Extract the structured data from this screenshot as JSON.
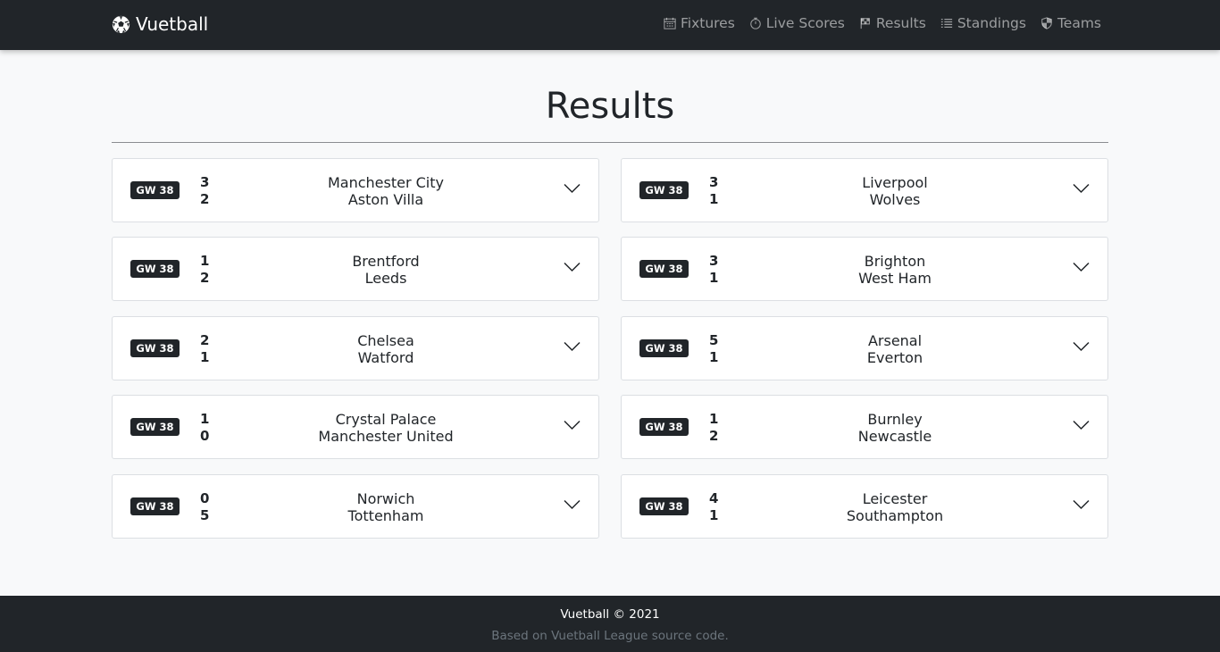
{
  "navbar": {
    "brand": "Vuetball",
    "brand_icon": "soccer-ball-icon",
    "links": [
      {
        "label": "Fixtures",
        "icon": "calendar-icon"
      },
      {
        "label": "Live Scores",
        "icon": "stopwatch-icon"
      },
      {
        "label": "Results",
        "icon": "flag-icon"
      },
      {
        "label": "Standings",
        "icon": "list-icon"
      },
      {
        "label": "Teams",
        "icon": "shield-icon"
      }
    ]
  },
  "page_title": "Results",
  "results": [
    {
      "gameweek": "GW 38",
      "home_score": "3",
      "away_score": "2",
      "home_team": "Manchester City",
      "away_team": "Aston Villa"
    },
    {
      "gameweek": "GW 38",
      "home_score": "3",
      "away_score": "1",
      "home_team": "Liverpool",
      "away_team": "Wolves"
    },
    {
      "gameweek": "GW 38",
      "home_score": "1",
      "away_score": "2",
      "home_team": "Brentford",
      "away_team": "Leeds"
    },
    {
      "gameweek": "GW 38",
      "home_score": "3",
      "away_score": "1",
      "home_team": "Brighton",
      "away_team": "West Ham"
    },
    {
      "gameweek": "GW 38",
      "home_score": "2",
      "away_score": "1",
      "home_team": "Chelsea",
      "away_team": "Watford"
    },
    {
      "gameweek": "GW 38",
      "home_score": "5",
      "away_score": "1",
      "home_team": "Arsenal",
      "away_team": "Everton"
    },
    {
      "gameweek": "GW 38",
      "home_score": "1",
      "away_score": "0",
      "home_team": "Crystal Palace",
      "away_team": "Manchester United"
    },
    {
      "gameweek": "GW 38",
      "home_score": "1",
      "away_score": "2",
      "home_team": "Burnley",
      "away_team": "Newcastle"
    },
    {
      "gameweek": "GW 38",
      "home_score": "0",
      "away_score": "5",
      "home_team": "Norwich",
      "away_team": "Tottenham"
    },
    {
      "gameweek": "GW 38",
      "home_score": "4",
      "away_score": "1",
      "home_team": "Leicester",
      "away_team": "Southampton"
    }
  ],
  "footer": {
    "copyright": "Vuetball © 2021",
    "credit": "Based on Vuetball League source code."
  },
  "colors": {
    "navbar_bg": "#212529",
    "page_bg": "#f8f9fa",
    "badge_bg": "#212529",
    "nav_link": "rgba(255,255,255,0.55)"
  }
}
